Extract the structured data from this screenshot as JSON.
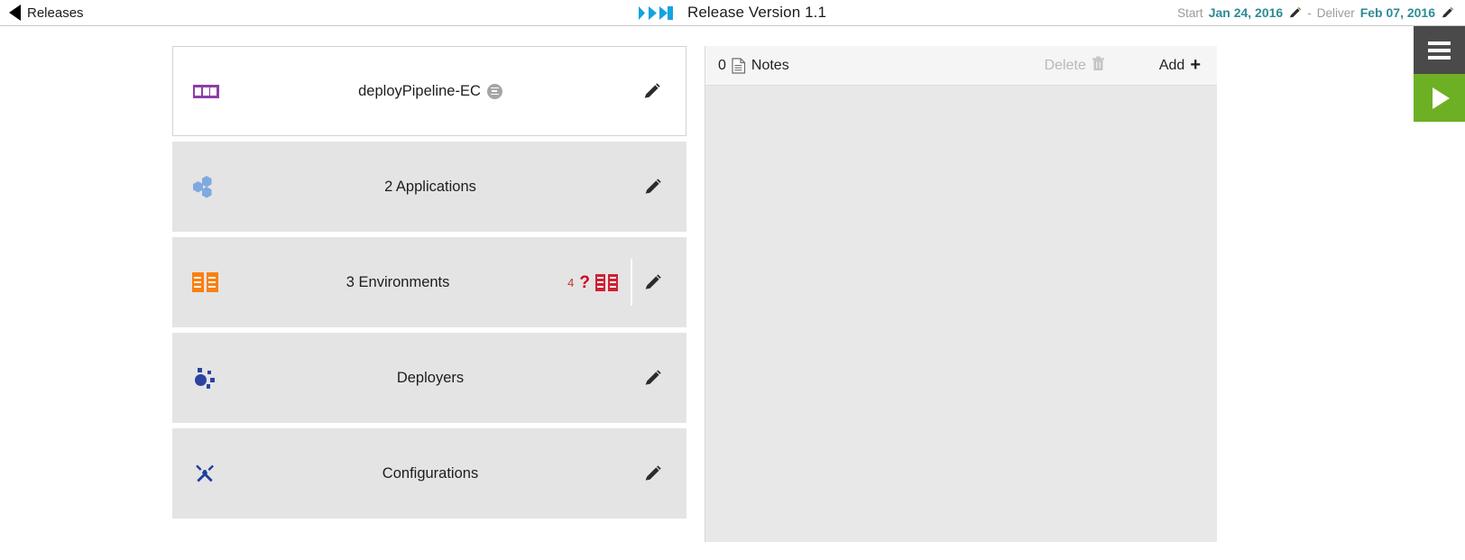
{
  "topbar": {
    "back_label": "Releases",
    "back_icon": "triangle-left-icon",
    "logo_icon": "chevron-triple-icon",
    "title": "Release Version 1.1",
    "start_label": "Start",
    "start_date": "Jan 24, 2016",
    "separator": "-",
    "deliver_label": "Deliver",
    "deliver_date": "Feb 07, 2016",
    "edit_icon": "pencil-icon",
    "accent_date_color": "#2e8b96"
  },
  "cards": [
    {
      "id": "pipeline",
      "icon": "pipeline-icon",
      "icon_color": "#8b3fa8",
      "title": "deployPipeline-EC",
      "badge_icon": "hamburger-badge-icon",
      "has_badge": true,
      "selected": true,
      "edit_icon": "pencil-icon"
    },
    {
      "id": "applications",
      "icon": "applications-hexagons-icon",
      "icon_color": "#7fa9e0",
      "title": "2 Applications",
      "selected": false,
      "edit_icon": "pencil-icon"
    },
    {
      "id": "environments",
      "icon": "server-rack-icon",
      "icon_color": "#f98012",
      "title": "3 Environments",
      "selected": false,
      "status_count": "4",
      "status_symbol": "?",
      "status_icon": "server-rack-red-icon",
      "status_color": "#cc2233",
      "edit_icon": "pencil-icon"
    },
    {
      "id": "deployers",
      "icon": "deployers-dots-icon",
      "icon_color": "#2c43a0",
      "title": "Deployers",
      "selected": false,
      "edit_icon": "pencil-icon"
    },
    {
      "id": "configurations",
      "icon": "tools-icon",
      "icon_color": "#1f3fa0",
      "title": "Configurations",
      "selected": false,
      "edit_icon": "pencil-icon"
    }
  ],
  "notes": {
    "count": "0",
    "doc_icon": "document-icon",
    "label": "Notes",
    "delete_label": "Delete",
    "delete_icon": "trash-icon",
    "delete_disabled": true,
    "add_label": "Add",
    "add_icon": "plus-icon",
    "body_text": ""
  },
  "rail": {
    "menu_icon": "hamburger-menu-icon",
    "menu_color": "#4a4a4a",
    "play_icon": "play-icon",
    "play_color": "#6eb023"
  }
}
